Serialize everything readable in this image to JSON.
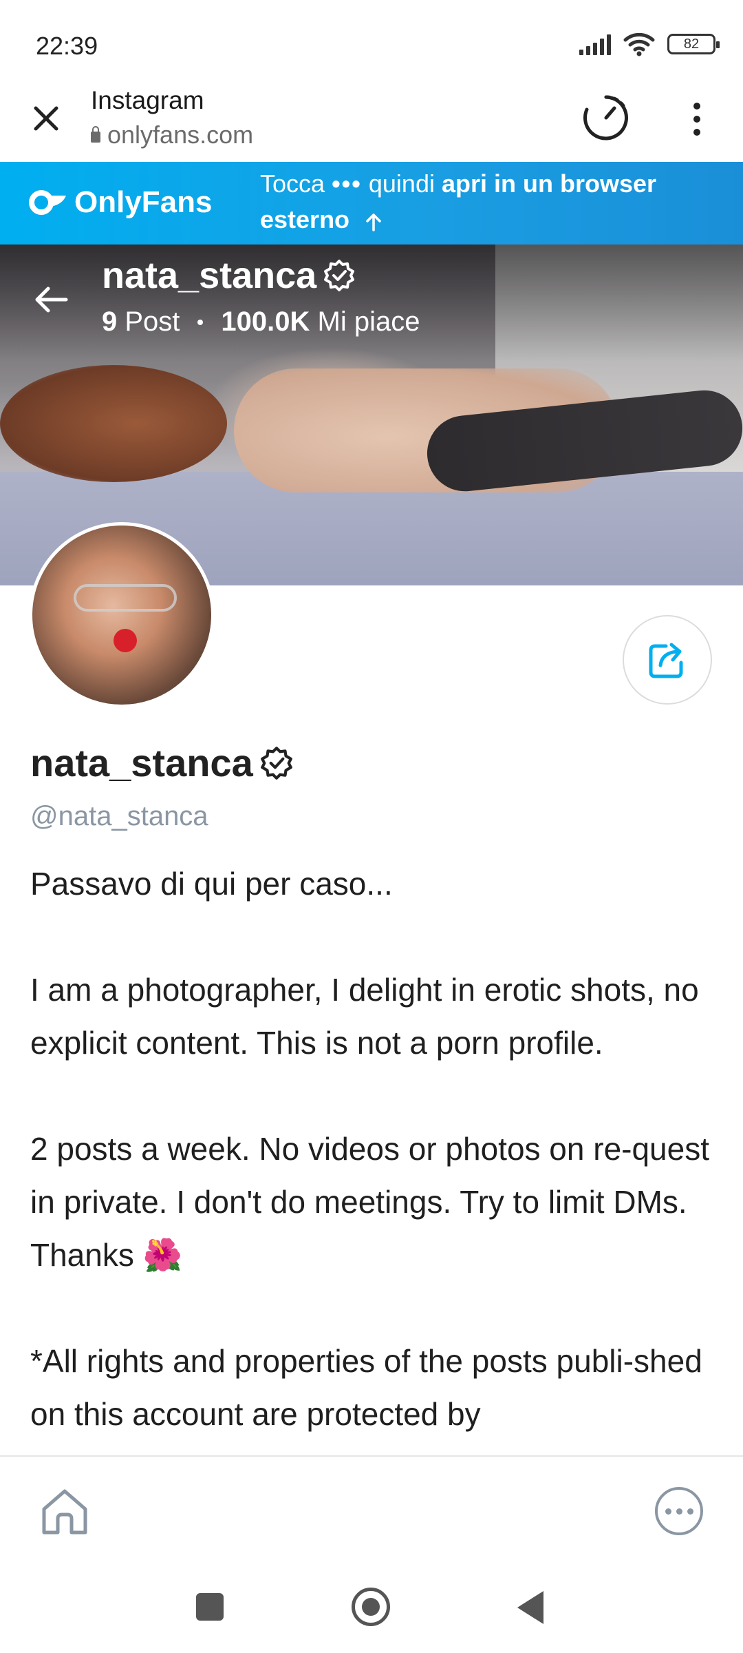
{
  "status_bar": {
    "time": "22:39",
    "battery": "82"
  },
  "tab_header": {
    "app_title": "Instagram",
    "url": "onlyfans.com"
  },
  "banner": {
    "logo_text": "OnlyFans",
    "text_prefix": "Tocca",
    "text_dots": "•••",
    "text_middle": " quindi ",
    "text_bold": "apri in un browser esterno",
    "accent_color": "#00aff0"
  },
  "cover": {
    "name": "nata_stanca",
    "posts_count": "9",
    "posts_label": "Post",
    "likes_count": "100.0K",
    "likes_label": "Mi piace"
  },
  "profile": {
    "name": "nata_stanca",
    "handle": "@nata_stanca",
    "bio": [
      "Passavo di qui per caso...",
      "I am a photographer, I delight in erotic shots, no explicit content. This is not a porn profile.",
      "2 posts a week. No videos or photos on re-quest in private. I don't do meetings. Try to limit DMs. Thanks 🌺",
      "*All rights and properties of the posts publi-shed on this account are protected by"
    ]
  },
  "icons": {
    "close": "close-icon",
    "timer": "timer-icon",
    "menu": "more-vert-icon",
    "back": "arrow-left-icon",
    "verified": "verified-badge-icon",
    "share": "share-icon",
    "home": "home-icon",
    "more": "more-horiz-icon"
  }
}
